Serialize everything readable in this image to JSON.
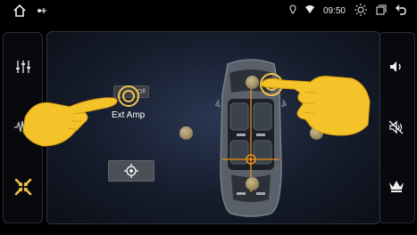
{
  "status": {
    "time": "09:50"
  },
  "left_nav": {
    "items": [
      {
        "name": "equalizer",
        "icon": "equalizer-icon",
        "active": false
      },
      {
        "name": "sound-wave",
        "icon": "sound-wave-icon",
        "active": false
      },
      {
        "name": "balance-fader",
        "icon": "balance-fader-icon",
        "active": true
      }
    ]
  },
  "right_nav": {
    "items": [
      {
        "icon": "volume-icon"
      },
      {
        "icon": "speaker-mute-icon"
      },
      {
        "icon": "crown-icon"
      }
    ]
  },
  "main": {
    "ext_amp_label": "Ext Amp",
    "ext_amp_box_text": "Off"
  },
  "colors": {
    "accent": "#f2c24a",
    "active_icon": "#f2c24a",
    "panel_border": "#2e3440",
    "marker": "#f08c1a"
  }
}
